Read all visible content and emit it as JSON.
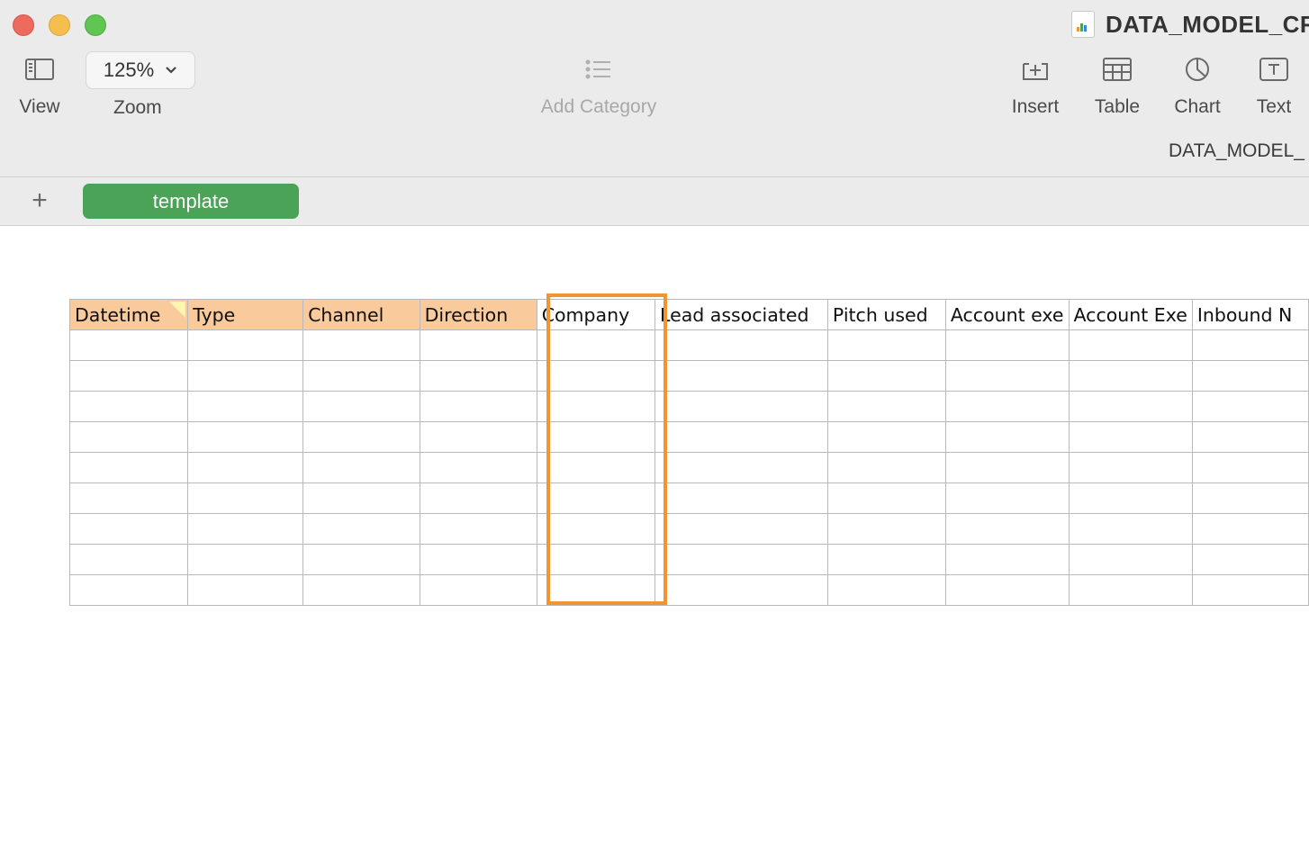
{
  "window": {
    "title": "DATA_MODEL_CR",
    "subtitle": "DATA_MODEL_"
  },
  "toolbar": {
    "view_label": "View",
    "zoom_value": "125%",
    "zoom_label": "Zoom",
    "add_category_label": "Add Category",
    "insert_label": "Insert",
    "table_label": "Table",
    "chart_label": "Chart",
    "text_label": "Text"
  },
  "sheets": {
    "add_symbol": "+",
    "active_tab": "template"
  },
  "table": {
    "columns": [
      "Datetime",
      "Type",
      "Channel",
      "Direction",
      "Company",
      "Lead associated",
      "Pitch used",
      "Account exe",
      "Account Exe",
      "Inbound N"
    ],
    "highlighted_columns": [
      "Datetime",
      "Type",
      "Channel",
      "Direction"
    ],
    "selected_column": "Company",
    "empty_rows": 9
  },
  "colors": {
    "header_highlight": "#f8ca9c",
    "selection_border": "#f0952f",
    "sheet_tab": "#4aa356"
  }
}
